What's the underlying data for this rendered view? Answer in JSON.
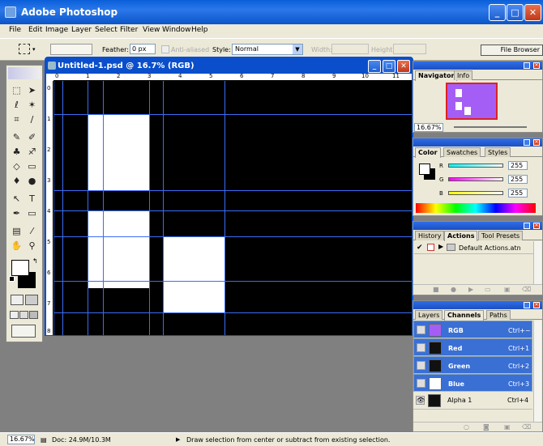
{
  "app": {
    "title": "Adobe Photoshop"
  },
  "window_buttons": {
    "minimize": "_",
    "maximize": "□",
    "close": "✕"
  },
  "menu": [
    "File",
    "Edit",
    "Image",
    "Layer",
    "Select",
    "Filter",
    "View",
    "Window",
    "Help"
  ],
  "options": {
    "feather_label": "Feather:",
    "feather_value": "0 px",
    "anti_aliased_label": "Anti-aliased",
    "style_label": "Style:",
    "style_value": "Normal",
    "width_label": "Width:",
    "height_label": "Height:",
    "file_browser": "File Browser"
  },
  "document": {
    "title": "Untitled-1.psd @ 16.7% (RGB)",
    "hruler": [
      "0",
      "1",
      "2",
      "3",
      "4",
      "5",
      "6",
      "7",
      "8",
      "9",
      "10",
      "11"
    ],
    "vruler": [
      "0",
      "1",
      "2",
      "3",
      "4",
      "5",
      "6",
      "7",
      "8"
    ]
  },
  "navigator": {
    "tabs": [
      "Navigator",
      "Info"
    ],
    "zoom": "16.67%"
  },
  "color": {
    "tabs": [
      "Color",
      "Swatches",
      "Styles"
    ],
    "channels": [
      {
        "label": "R",
        "value": "255"
      },
      {
        "label": "G",
        "value": "255"
      },
      {
        "label": "B",
        "value": "255"
      }
    ]
  },
  "actions": {
    "tabs": [
      "History",
      "Actions",
      "Tool Presets"
    ],
    "item": "Default Actions.atn"
  },
  "channels_panel": {
    "tabs": [
      "Layers",
      "Channels",
      "Paths"
    ],
    "rows": [
      {
        "name": "RGB",
        "shortcut": "Ctrl+~"
      },
      {
        "name": "Red",
        "shortcut": "Ctrl+1"
      },
      {
        "name": "Green",
        "shortcut": "Ctrl+2"
      },
      {
        "name": "Blue",
        "shortcut": "Ctrl+3"
      },
      {
        "name": "Alpha 1",
        "shortcut": "Ctrl+4"
      }
    ]
  },
  "status": {
    "zoom": "16.67%",
    "doc": "Doc: 24.9M/10.3M",
    "hint": "Draw selection from center or subtract from existing selection."
  }
}
